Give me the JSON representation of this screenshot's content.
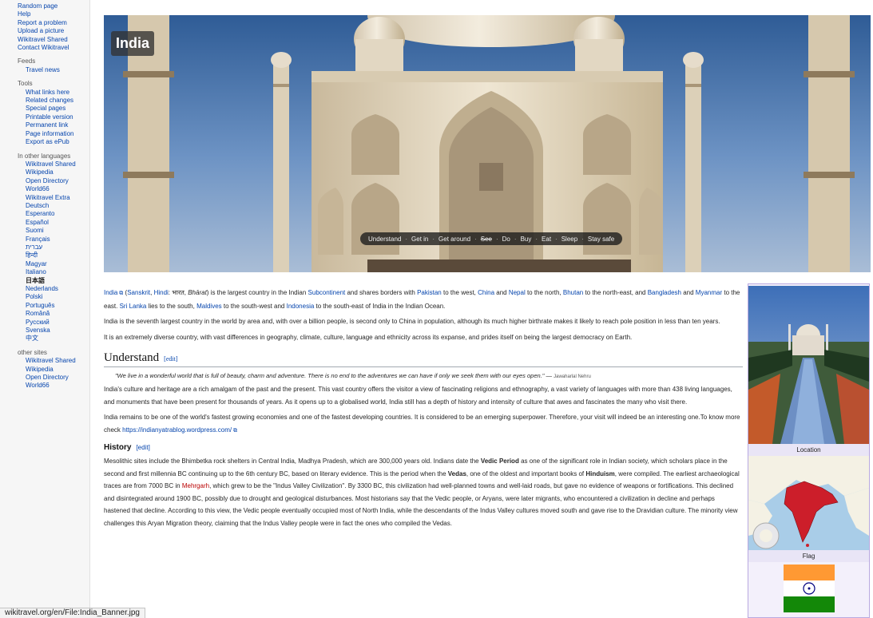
{
  "sidebar": {
    "top_items": [
      "Random page",
      "Help",
      "Report a problem",
      "Upload a picture",
      "Wikitravel Shared",
      "Contact Wikitravel"
    ],
    "feeds_title": "Feeds",
    "feeds_items": [
      "Travel news"
    ],
    "tools_title": "Tools",
    "tools_items": [
      "What links here",
      "Related changes",
      "Special pages",
      "Printable version",
      "Permanent link",
      "Page information",
      "Export as ePub"
    ],
    "languages_title": "In other languages",
    "languages_items": [
      "Wikitravel Shared",
      "Wikipedia",
      "Open Directory",
      "World66",
      "Wikitravel Extra",
      "Deutsch",
      "Esperanto",
      "Español",
      "Suomi",
      "Français",
      "עברית",
      "हिन्दी",
      "Magyar",
      "Italiano",
      "日本語",
      "Nederlands",
      "Polski",
      "Português",
      "Română",
      "Русский",
      "Svenska",
      "中文"
    ],
    "othersites_title": "other sites",
    "othersites_items": [
      "Wikitravel Shared",
      "Wikipedia",
      "Open Directory",
      "World66"
    ]
  },
  "banner": {
    "title": "India",
    "nav": [
      {
        "label": "Understand",
        "strike": false
      },
      {
        "label": "Get in",
        "strike": false
      },
      {
        "label": "Get around",
        "strike": false
      },
      {
        "label": "See",
        "strike": true
      },
      {
        "label": "Do",
        "strike": false
      },
      {
        "label": "Buy",
        "strike": false
      },
      {
        "label": "Eat",
        "strike": false
      },
      {
        "label": "Sleep",
        "strike": false
      },
      {
        "label": "Stay safe",
        "strike": false
      }
    ]
  },
  "article": {
    "intro1": {
      "india_link": "India",
      "t1": " (",
      "sanskrit": "Sanskrit",
      "t2": ", ",
      "hindi": "Hindi",
      "t3": ": भारत, ",
      "bharat": "Bhārat",
      "t4": ") is the largest country in the Indian ",
      "subcontinent": "Subcontinent",
      "t5": " and shares borders with ",
      "pakistan": "Pakistan",
      "t6": " to the west, ",
      "china": "China",
      "t7": " and ",
      "nepal": "Nepal",
      "t8": " to the north, ",
      "bhutan": "Bhutan",
      "t9": " to the north-east, and ",
      "bangladesh": "Bangladesh",
      "t10": " and ",
      "myanmar": "Myanmar",
      "t11": " to the east. ",
      "srilanka": "Sri Lanka",
      "t12": " lies to the south, ",
      "maldives": "Maldives",
      "t13": " to the south-west and ",
      "indonesia": "Indonesia",
      "t14": " to the south-east of India in the Indian Ocean."
    },
    "intro2": "India is the seventh largest country in the world by area and, with over a billion people, is second only to China in population, although its much higher birthrate makes it likely to reach pole position in less than ten years.",
    "intro3": "It is an extremely diverse country, with vast differences in geography, climate, culture, language and ethnicity across its expanse, and prides itself on being the largest democracy on Earth.",
    "understand_heading": "Understand",
    "edit_label": "[edit]",
    "quote": "\"We live in a wonderful world that is full of beauty, charm and adventure. There is no end to the adventures we can have if only we seek them with our eyes open.\"",
    "quote_dash": " — ",
    "quote_author": "Jawaharlal Nehru",
    "understand_p1": "India's culture and heritage are a rich amalgam of the past and the present. This vast country offers the visitor a view of fascinating religions and ethnography, a vast variety of languages with more than 438 living languages, and monuments that have been present for thousands of years. As it opens up to a globalised world, India still has a depth of history and intensity of culture that awes and fascinates the many who visit there.",
    "understand_p2_text": "India remains to be one of the world's fastest growing economies and one of the fastest developing countries. It is considered to be an emerging superpower. Therefore, your visit will indeed be an interesting one.To know more check ",
    "understand_p2_link": "https://indianyatrablog.wordpress.com/",
    "history_heading": "History",
    "history": {
      "t1": "Mesolithic sites include the Bhimbetka rock shelters in Central India, Madhya Pradesh, which are 300,000 years old. Indians date the ",
      "b1": "Vedic Period",
      "t2": " as one of the significant role in Indian society, which scholars place in the second and first millennia BC continuing up to the 6th century BC, based on literary evidence. This is the period when the ",
      "b2": "Vedas",
      "t3": ", one of the oldest and important books of ",
      "b3": "Hinduism",
      "t4": ", were compiled. The earliest archaeological traces are from 7000 BC in ",
      "mehrgarh": "Mehrgarh",
      "t5": ", which grew to be the \"Indus Valley Civilization\". By 3300 BC, this civilization had well-planned towns and well-laid roads, but gave no evidence of weapons or fortifications. This declined and disintegrated around 1900 BC, possibly due to drought and geological disturbances. Most historians say that the Vedic people, or Aryans, were later migrants, who encountered a civilization in decline and perhaps hastened that decline. According to this view, the Vedic people eventually occupied most of North India, while the descendants of the Indus Valley cultures moved south and gave rise to the Dravidian culture. The minority view challenges this Aryan Migration theory, claiming that the Indus Valley people were in fact the ones who compiled the Vedas."
    }
  },
  "infobox": {
    "location_label": "Location",
    "flag_label": "Flag"
  },
  "status_bar": "wikitravel.org/en/File:India_Banner.jpg",
  "colors": {
    "link": "#0645ad",
    "sky_top": "#2f5c96",
    "marble": "#ece3d1",
    "flag_saffron": "#ff9933",
    "flag_green": "#138808",
    "chakra": "#000080"
  }
}
